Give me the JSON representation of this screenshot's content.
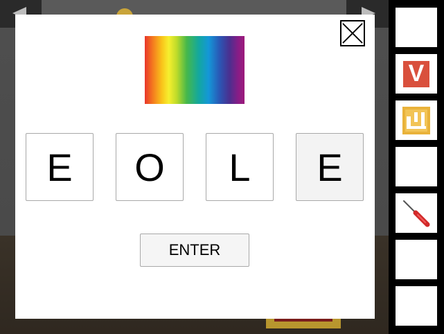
{
  "code_panel": {
    "letters": [
      "E",
      "O",
      "L",
      "E"
    ],
    "enter_label": "ENTER"
  },
  "inventory": {
    "slots": [
      {
        "item": "empty"
      },
      {
        "item": "v-card",
        "label": "V",
        "color": "#d9503d"
      },
      {
        "item": "bar-chart-card",
        "color": "#e9b23a"
      },
      {
        "item": "empty"
      },
      {
        "item": "screwdriver",
        "color": "#d22a2a"
      },
      {
        "item": "empty"
      },
      {
        "item": "empty"
      }
    ]
  },
  "colors": {
    "modal_bg": "#ffffff",
    "sidebar_bg": "#000000",
    "tile_border": "#a8a8a8"
  }
}
